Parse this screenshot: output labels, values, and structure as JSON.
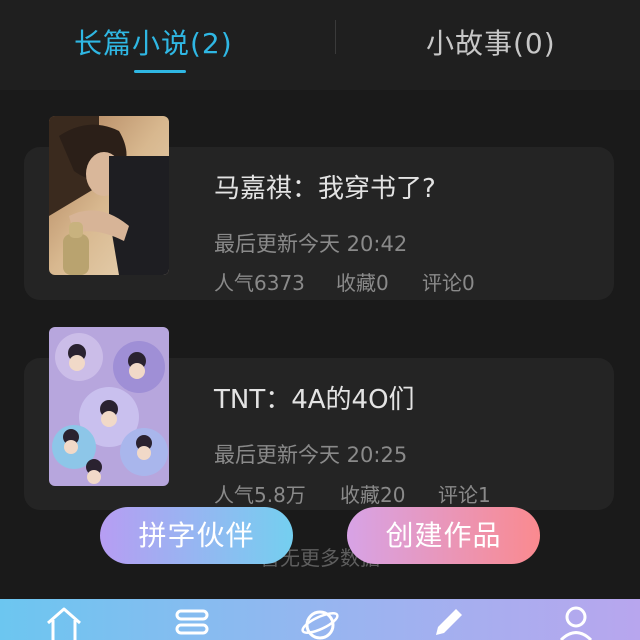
{
  "tabs": [
    {
      "label": "长篇小说(2)",
      "active": true
    },
    {
      "label": "小故事(0)",
      "active": false
    }
  ],
  "works": [
    {
      "title": "马嘉祺：我穿书了?",
      "updated": "最后更新今天 20:42",
      "popularity": "人气6373",
      "favorites": "收藏0",
      "comments": "评论0"
    },
    {
      "title": "TNT：4A的4O们",
      "updated": "最后更新今天 20:25",
      "popularity": "人气5.8万",
      "favorites": "收藏20",
      "comments": "评论1"
    }
  ],
  "footer": {
    "no_more": "暂无更多数据"
  },
  "actions": {
    "partner": "拼字伙伴",
    "create": "创建作品"
  },
  "bottom_nav": {
    "icons": [
      "home-icon",
      "list-icon",
      "planet-icon",
      "pencil-icon",
      "user-icon"
    ]
  },
  "colors": {
    "accent": "#2fb7e3",
    "background": "#1a1a1a",
    "card": "#242424"
  }
}
